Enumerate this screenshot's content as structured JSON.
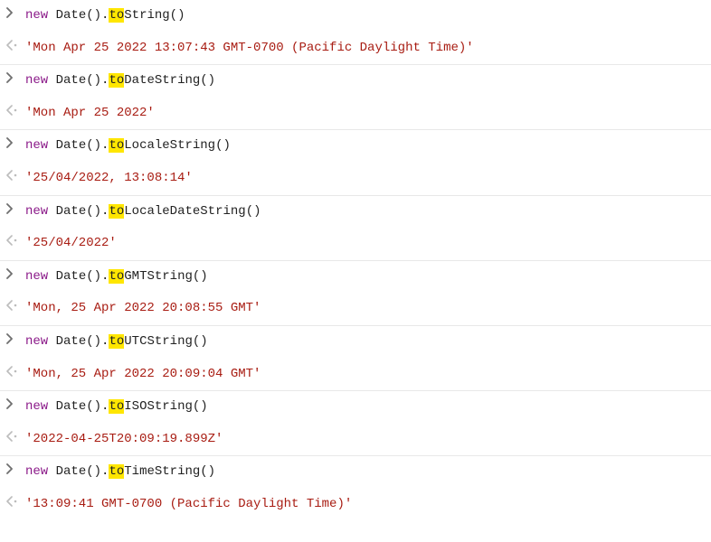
{
  "console": {
    "entries": [
      {
        "input": {
          "kw": "new",
          "cls": "Date",
          "pre": ".",
          "hl": "to",
          "post": "String()"
        },
        "output": "'Mon Apr 25 2022 13:07:43 GMT-0700 (Pacific Daylight Time)'"
      },
      {
        "input": {
          "kw": "new",
          "cls": "Date",
          "pre": ".",
          "hl": "to",
          "post": "DateString()"
        },
        "output": "'Mon Apr 25 2022'"
      },
      {
        "input": {
          "kw": "new",
          "cls": "Date",
          "pre": ".",
          "hl": "to",
          "post": "LocaleString()"
        },
        "output": "'25/04/2022, 13:08:14'"
      },
      {
        "input": {
          "kw": "new",
          "cls": "Date",
          "pre": ".",
          "hl": "to",
          "post": "LocaleDateString()"
        },
        "output": "'25/04/2022'"
      },
      {
        "input": {
          "kw": "new",
          "cls": "Date",
          "pre": ".",
          "hl": "to",
          "post": "GMTString()"
        },
        "output": "'Mon, 25 Apr 2022 20:08:55 GMT'"
      },
      {
        "input": {
          "kw": "new",
          "cls": "Date",
          "pre": ".",
          "hl": "to",
          "post": "UTCString()"
        },
        "output": "'Mon, 25 Apr 2022 20:09:04 GMT'"
      },
      {
        "input": {
          "kw": "new",
          "cls": "Date",
          "pre": ".",
          "hl": "to",
          "post": "ISOString()"
        },
        "output": "'2022-04-25T20:09:19.899Z'"
      },
      {
        "input": {
          "kw": "new",
          "cls": "Date",
          "pre": ".",
          "hl": "to",
          "post": "TimeString()"
        },
        "output": "'13:09:41 GMT-0700 (Pacific Daylight Time)'"
      }
    ]
  },
  "icons": {
    "input_prompt": "❯",
    "output_prompt": "⟨·"
  }
}
